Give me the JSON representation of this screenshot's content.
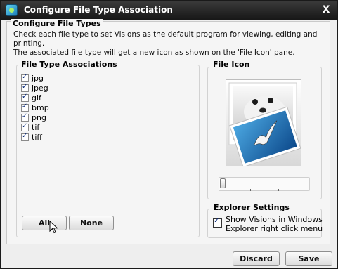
{
  "window": {
    "title": "Configure File Type Association",
    "close_label": "X"
  },
  "configure": {
    "title": "Configure File Types",
    "description_line1": "Check each file type to set Visions as the default program for viewing, editing and printing.",
    "description_line2": "The associated file type will get a new icon as shown on the 'File Icon' pane."
  },
  "associations": {
    "title": "File Type Associations",
    "items": [
      {
        "label": "jpg",
        "checked": true
      },
      {
        "label": "jpeg",
        "checked": true
      },
      {
        "label": "gif",
        "checked": true
      },
      {
        "label": "bmp",
        "checked": true
      },
      {
        "label": "png",
        "checked": true
      },
      {
        "label": "tif",
        "checked": true
      },
      {
        "label": "tiff",
        "checked": true
      }
    ],
    "all_label": "All",
    "none_label": "None"
  },
  "file_icon": {
    "title": "File Icon",
    "slider_value": 0
  },
  "explorer": {
    "title": "Explorer Settings",
    "checked": true,
    "line1": "Show Visions in Windows",
    "line2": "Explorer right click menu"
  },
  "footer": {
    "discard_label": "Discard",
    "save_label": "Save"
  },
  "colors": {
    "title_bar": "#222222",
    "accent_blue": "#1f6fb5"
  }
}
